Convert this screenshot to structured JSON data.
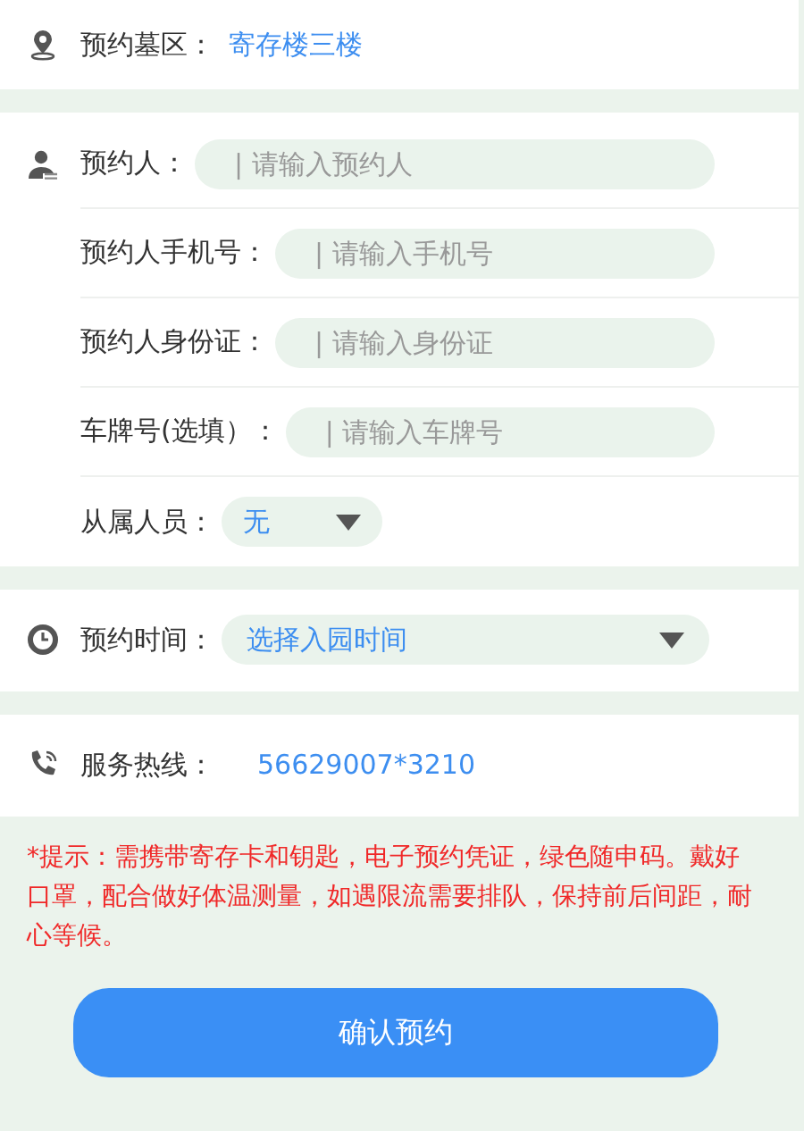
{
  "area": {
    "label": "预约墓区：",
    "value": "寄存楼三楼"
  },
  "visitor_rows": [
    {
      "kind": "input",
      "label": "预约人：",
      "placeholder": "| 请输入预约人"
    },
    {
      "kind": "input",
      "label": "预约人手机号：",
      "placeholder": "| 请输入手机号"
    },
    {
      "kind": "input",
      "label": "预约人身份证：",
      "placeholder": "| 请输入身份证"
    },
    {
      "kind": "input",
      "label": "车牌号(选填）：",
      "placeholder": "| 请输入车牌号"
    },
    {
      "kind": "select",
      "label": "从属人员：",
      "value": "无"
    }
  ],
  "time": {
    "label": "预约时间：",
    "value": "选择入园时间"
  },
  "hotline": {
    "label": "服务热线：",
    "value": "56629007*3210"
  },
  "notice": "*提示：需携带寄存卡和钥匙，电子预约凭证，绿色随申码。戴好口罩，配合做好体温测量，如遇限流需要排队，保持前后间距，耐心等候。",
  "confirm_button": "确认预约"
}
